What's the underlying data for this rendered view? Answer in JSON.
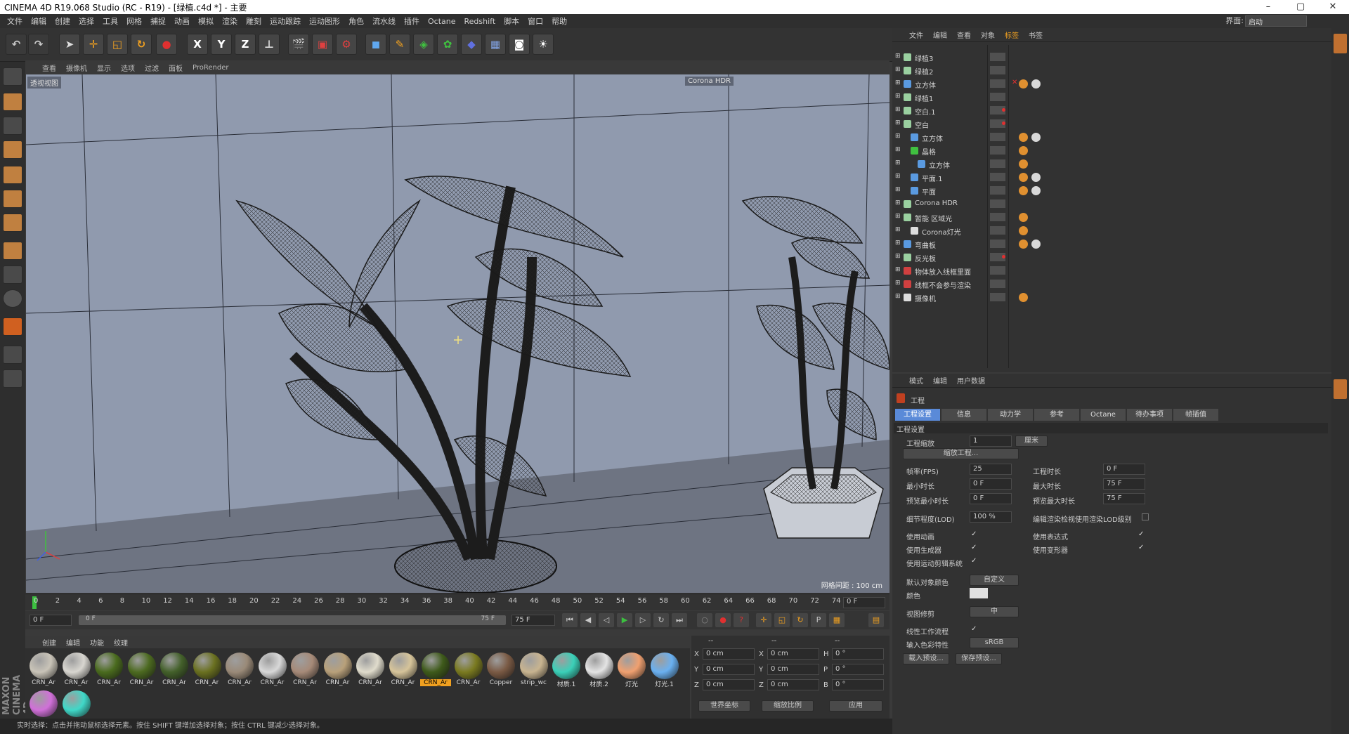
{
  "window": {
    "title": "CINEMA 4D R19.068 Studio (RC - R19) - [绿植.c4d *] - 主要",
    "minimize": "–",
    "restore": "▢",
    "close": "✕"
  },
  "menu": [
    "文件",
    "编辑",
    "创建",
    "选择",
    "工具",
    "网格",
    "捕捉",
    "动画",
    "模拟",
    "渲染",
    "雕刻",
    "运动跟踪",
    "运动图形",
    "角色",
    "流水线",
    "插件",
    "Octane",
    "Redshift",
    "脚本",
    "窗口",
    "帮助"
  ],
  "layout": {
    "label": "界面:",
    "value": "启动"
  },
  "viewport": {
    "menu": [
      "查看",
      "摄像机",
      "显示",
      "选项",
      "过滤",
      "面板",
      "ProRender"
    ],
    "label": "透视视图",
    "corona": "Corona HDR",
    "grid_info": "网格间距 : 100 cm"
  },
  "timeline": {
    "ticks": [
      "0",
      "2",
      "4",
      "6",
      "8",
      "10",
      "12",
      "14",
      "16",
      "18",
      "20",
      "22",
      "24",
      "26",
      "28",
      "30",
      "32",
      "34",
      "36",
      "38",
      "40",
      "42",
      "44",
      "46",
      "48",
      "50",
      "52",
      "54",
      "56",
      "58",
      "60",
      "62",
      "64",
      "66",
      "68",
      "70",
      "72",
      "74"
    ],
    "current": "0 F",
    "start": "0 F",
    "slider_start": "0 F",
    "slider_end": "75 F",
    "end": "75 F"
  },
  "materials": {
    "tabs": [
      "创建",
      "编辑",
      "功能",
      "纹理"
    ],
    "items": [
      {
        "name": "CRN_Ar",
        "color": "#c9c4b8"
      },
      {
        "name": "CRN_Ar",
        "color": "#d8d6d0"
      },
      {
        "name": "CRN_Ar",
        "color": "#4a6b1e"
      },
      {
        "name": "CRN_Ar",
        "color": "#4c6a20"
      },
      {
        "name": "CRN_Ar",
        "color": "#43602a"
      },
      {
        "name": "CRN_Ar",
        "color": "#6a7020"
      },
      {
        "name": "CRN_Ar",
        "color": "#9a8a78"
      },
      {
        "name": "CRN_Ar",
        "color": "#d8d8d8"
      },
      {
        "name": "CRN_Ar",
        "color": "#a68a78"
      },
      {
        "name": "CRN_Ar",
        "color": "#b8a07a"
      },
      {
        "name": "CRN_Ar",
        "color": "#e0dccc"
      },
      {
        "name": "CRN_Ar",
        "color": "#d6c49a"
      },
      {
        "name": "CRN_Ar",
        "color": "#3e5a1a",
        "selected": true
      },
      {
        "name": "CRN_Ar",
        "color": "#7a7a20"
      },
      {
        "name": "Copper",
        "color": "#7a5a44"
      },
      {
        "name": "strip_wc",
        "color": "#c8b490"
      },
      {
        "name": "材质.1",
        "color": "#3ad0b8"
      },
      {
        "name": "材质.2",
        "color": "#e4e4e4"
      },
      {
        "name": "灯光",
        "color": "#f0a070"
      },
      {
        "name": "灯光.1",
        "color": "#6ab0f0"
      },
      {
        "name": "",
        "color": "#d070d8"
      },
      {
        "name": "",
        "color": "#40d8c8"
      }
    ]
  },
  "coords": {
    "header": [
      "--",
      "--",
      "--"
    ],
    "rows": [
      {
        "a": "X",
        "av": "0 cm",
        "b": "X",
        "bv": "0 cm",
        "c": "H",
        "cv": "0 °"
      },
      {
        "a": "Y",
        "av": "0 cm",
        "b": "Y",
        "bv": "0 cm",
        "c": "P",
        "cv": "0 °"
      },
      {
        "a": "Z",
        "av": "0 cm",
        "b": "Z",
        "bv": "0 cm",
        "c": "B",
        "cv": "0 °"
      }
    ],
    "world": "世界坐标",
    "scale": "缩放比例",
    "apply": "应用"
  },
  "objects": {
    "tabs": [
      "文件",
      "编辑",
      "查看",
      "对象",
      "标签",
      "书签"
    ],
    "rows": [
      {
        "name": "绿植3",
        "indent": 0,
        "icon": "null"
      },
      {
        "name": "绿植2",
        "indent": 0,
        "icon": "null"
      },
      {
        "name": "立方体",
        "indent": 0,
        "icon": "cube",
        "tags": 2,
        "x": true
      },
      {
        "name": "绿植1",
        "indent": 0,
        "icon": "null"
      },
      {
        "name": "空白.1",
        "indent": 0,
        "icon": "null",
        "red": true
      },
      {
        "name": "空白",
        "indent": 0,
        "icon": "null",
        "red": true
      },
      {
        "name": "立方体",
        "indent": 1,
        "icon": "cube",
        "tags": 2
      },
      {
        "name": "晶格",
        "indent": 1,
        "icon": "lattice",
        "tags": 1
      },
      {
        "name": "立方体",
        "indent": 2,
        "icon": "cube",
        "tags": 1
      },
      {
        "name": "平面.1",
        "indent": 1,
        "icon": "plane",
        "tags": 2
      },
      {
        "name": "平面",
        "indent": 1,
        "icon": "plane",
        "tags": 2
      },
      {
        "name": "Corona HDR",
        "indent": 0,
        "icon": "null"
      },
      {
        "name": "暂能 区域光",
        "indent": 0,
        "icon": "null",
        "tags": 1
      },
      {
        "name": "Corona灯光",
        "indent": 1,
        "icon": "q",
        "tags": 1
      },
      {
        "name": "弯曲板",
        "indent": 0,
        "icon": "plane",
        "tags": 2
      },
      {
        "name": "反光板",
        "indent": 0,
        "icon": "null",
        "red": true
      },
      {
        "name": "物体放入线框里面",
        "indent": 0,
        "icon": "red"
      },
      {
        "name": "线框不会参与渲染",
        "indent": 0,
        "icon": "red"
      },
      {
        "name": "摄像机",
        "indent": 0,
        "icon": "camera",
        "tags": 1
      }
    ]
  },
  "attributes": {
    "tabs": [
      "模式",
      "编辑",
      "用户数据"
    ],
    "object": "工程",
    "subtabs": [
      "工程设置",
      "信息",
      "动力学",
      "参考",
      "Octane Render",
      "待办事项",
      "帧插值"
    ],
    "section": "工程设置",
    "scale_label": "工程缩放",
    "scale_value": "1",
    "scale_unit": "厘米",
    "scale_btn": "缩放工程...",
    "fps_label": "帧率(FPS)",
    "fps": "25",
    "min_label": "最小时长",
    "min": "0 F",
    "pmin_label": "预览最小时长",
    "pmin": "0 F",
    "dur_label": "工程时长",
    "dur": "0 F",
    "max_label": "最大时长",
    "max": "75 F",
    "pmax_label": "预览最大时长",
    "pmax": "75 F",
    "lod_label": "细节程度(LOD)",
    "lod": "100 %",
    "lod_render": "编辑渲染检视使用渲染LOD级别",
    "use_anim": "使用动画",
    "use_expr": "使用表达式",
    "use_gen": "使用生成器",
    "use_deform": "使用变形器",
    "use_motion": "使用运动剪辑系统",
    "defcolor_label": "默认对象颜色",
    "defcolor": "自定义",
    "color_label": "颜色",
    "clip_label": "视图修剪",
    "clip": "中",
    "linear_label": "线性工作流程",
    "input_label": "输入色彩特性",
    "input": "sRGB",
    "load": "载入预设...",
    "save": "保存预设..."
  },
  "status": "实时选择：点击并拖动鼠标选择元素。按住 SHIFT 键增加选择对象；按住 CTRL 键减少选择对象。"
}
